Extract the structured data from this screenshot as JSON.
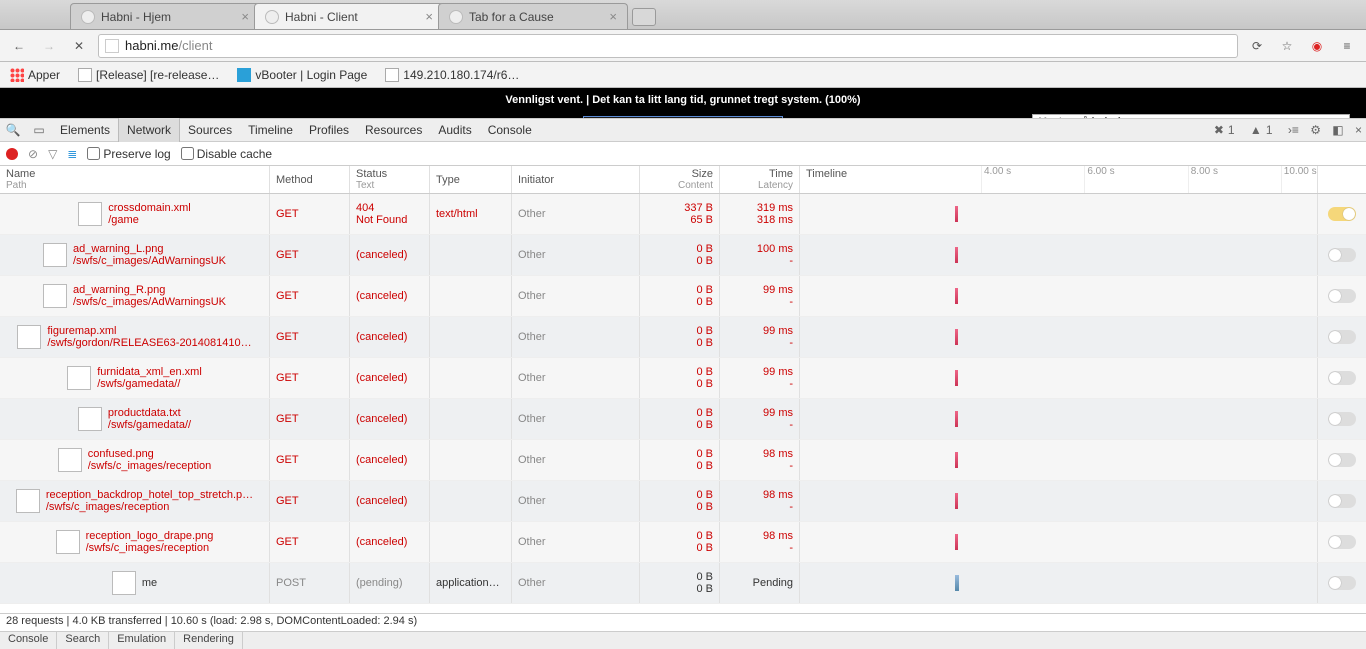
{
  "browser": {
    "tabs": [
      "Habni - Hjem",
      "Habni - Client",
      "Tab for a Cause"
    ],
    "url_host": "habni.me",
    "url_path": "/client",
    "bookmarks": {
      "apper": "Apper",
      "release": "[Release] [re-release…",
      "vbooter": "vBooter | Login Page",
      "ip": "149.210.180.174/r6…"
    }
  },
  "page": {
    "banner": "Vennligst vent. | Det kan ta litt lang tid, grunnet tregt system. (100%)",
    "status": "Venter på habni.me..."
  },
  "devtools": {
    "tabs": [
      "Elements",
      "Network",
      "Sources",
      "Timeline",
      "Profiles",
      "Resources",
      "Audits",
      "Console"
    ],
    "active_tab": "Network",
    "errors": 1,
    "warnings": 1,
    "filterbar": {
      "preserve": "Preserve log",
      "disable": "Disable cache"
    },
    "columns": {
      "name": "Name",
      "name_sub": "Path",
      "method": "Method",
      "status": "Status",
      "status_sub": "Text",
      "type": "Type",
      "init": "Initiator",
      "size": "Size",
      "size_sub": "Content",
      "time": "Time",
      "time_sub": "Latency",
      "timeline": "Timeline"
    },
    "ticks": [
      "4.00 s",
      "6.00 s",
      "8.00 s",
      "10.00 s"
    ],
    "rows": [
      {
        "file": "crossdomain.xml",
        "path": "/game",
        "method": "GET",
        "status": "404",
        "status_text": "Not Found",
        "type": "text/html",
        "init": "Other",
        "size": "337 B",
        "content": "65 B",
        "time": "319 ms",
        "latency": "318 ms",
        "err": true,
        "toggle": true,
        "bar": 30
      },
      {
        "file": "ad_warning_L.png",
        "path": "/swfs/c_images/AdWarningsUK",
        "method": "GET",
        "status": "(canceled)",
        "status_text": "",
        "type": "",
        "init": "Other",
        "size": "0 B",
        "content": "0 B",
        "time": "100 ms",
        "latency": "-",
        "err": true,
        "bar": 30
      },
      {
        "file": "ad_warning_R.png",
        "path": "/swfs/c_images/AdWarningsUK",
        "method": "GET",
        "status": "(canceled)",
        "status_text": "",
        "type": "",
        "init": "Other",
        "size": "0 B",
        "content": "0 B",
        "time": "99 ms",
        "latency": "-",
        "err": true,
        "bar": 30
      },
      {
        "file": "figuremap.xml",
        "path": "/swfs/gordon/RELEASE63-2014081410…",
        "method": "GET",
        "status": "(canceled)",
        "status_text": "",
        "type": "",
        "init": "Other",
        "size": "0 B",
        "content": "0 B",
        "time": "99 ms",
        "latency": "-",
        "err": true,
        "bar": 30
      },
      {
        "file": "furnidata_xml_en.xml",
        "path": "/swfs/gamedata//",
        "method": "GET",
        "status": "(canceled)",
        "status_text": "",
        "type": "",
        "init": "Other",
        "size": "0 B",
        "content": "0 B",
        "time": "99 ms",
        "latency": "-",
        "err": true,
        "bar": 30
      },
      {
        "file": "productdata.txt",
        "path": "/swfs/gamedata//",
        "method": "GET",
        "status": "(canceled)",
        "status_text": "",
        "type": "",
        "init": "Other",
        "size": "0 B",
        "content": "0 B",
        "time": "99 ms",
        "latency": "-",
        "err": true,
        "bar": 30
      },
      {
        "file": "confused.png",
        "path": "/swfs/c_images/reception",
        "method": "GET",
        "status": "(canceled)",
        "status_text": "",
        "type": "",
        "init": "Other",
        "size": "0 B",
        "content": "0 B",
        "time": "98 ms",
        "latency": "-",
        "err": true,
        "bar": 30
      },
      {
        "file": "reception_backdrop_hotel_top_stretch.p…",
        "path": "/swfs/c_images/reception",
        "method": "GET",
        "status": "(canceled)",
        "status_text": "",
        "type": "",
        "init": "Other",
        "size": "0 B",
        "content": "0 B",
        "time": "98 ms",
        "latency": "-",
        "err": true,
        "bar": 30
      },
      {
        "file": "reception_logo_drape.png",
        "path": "/swfs/c_images/reception",
        "method": "GET",
        "status": "(canceled)",
        "status_text": "",
        "type": "",
        "init": "Other",
        "size": "0 B",
        "content": "0 B",
        "time": "98 ms",
        "latency": "-",
        "err": true,
        "bar": 30
      },
      {
        "file": "me",
        "path": "",
        "method": "POST",
        "status": "(pending)",
        "status_text": "",
        "type": "application…",
        "init": "Other",
        "size": "0 B",
        "content": "0 B",
        "time": "",
        "latency": "Pending",
        "err": false,
        "pending": true,
        "bar": 30
      }
    ],
    "summary": "28 requests | 4.0 KB transferred | 10.60 s (load: 2.98 s, DOMContentLoaded: 2.94 s)",
    "drawer": [
      "Console",
      "Search",
      "Emulation",
      "Rendering"
    ]
  }
}
